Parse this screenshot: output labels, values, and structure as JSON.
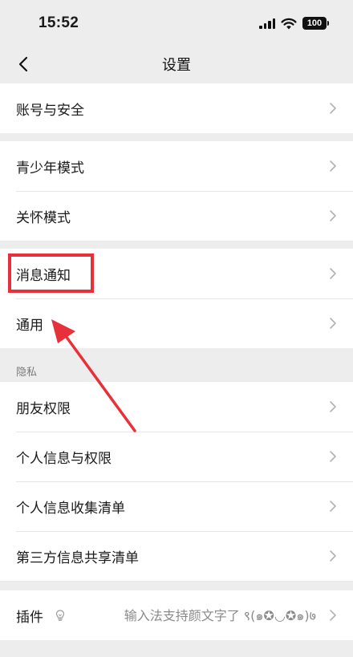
{
  "status_bar": {
    "time": "15:52",
    "battery": "100"
  },
  "nav": {
    "title": "设置"
  },
  "groups": [
    {
      "items": [
        {
          "label": "账号与安全"
        }
      ]
    },
    {
      "items": [
        {
          "label": "青少年模式"
        },
        {
          "label": "关怀模式"
        }
      ]
    },
    {
      "items": [
        {
          "label": "消息通知"
        },
        {
          "label": "通用"
        }
      ]
    },
    {
      "header": "隐私",
      "items": [
        {
          "label": "朋友权限"
        },
        {
          "label": "个人信息与权限"
        },
        {
          "label": "个人信息收集清单"
        },
        {
          "label": "第三方信息共享清单"
        }
      ]
    },
    {
      "items": [
        {
          "label": "插件",
          "subtitle": "输入法支持颜文字了 ९(๑✪◡✪๑)७",
          "icon": "lightbulb-icon"
        }
      ]
    }
  ],
  "annotation": {
    "highlight_color": "#e8303a",
    "highlighted_item": "消息通知",
    "arrow_color": "#e8303a"
  }
}
